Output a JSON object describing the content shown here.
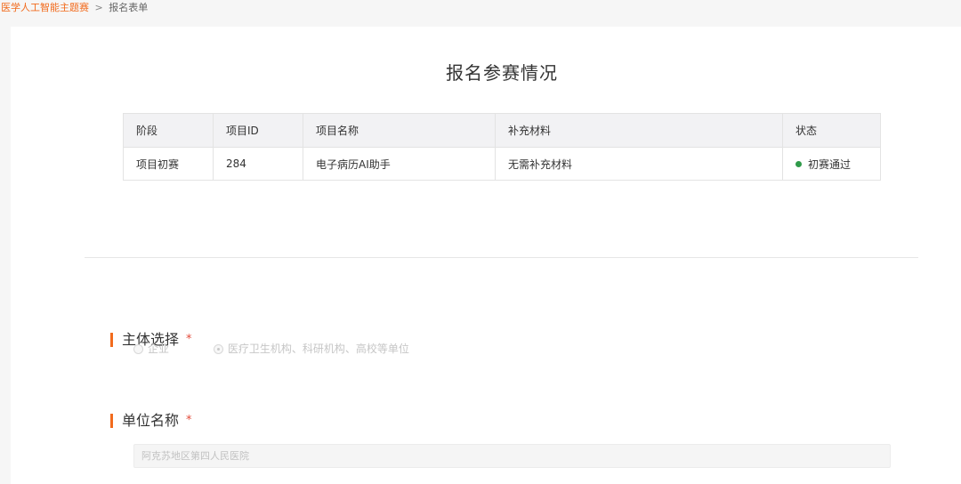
{
  "breadcrumb": {
    "parent": "医学人工智能主题赛",
    "separator": ">",
    "current": "报名表单"
  },
  "page_title": "报名参赛情况",
  "table": {
    "headers": [
      "阶段",
      "项目ID",
      "项目名称",
      "补充材料",
      "状态"
    ],
    "rows": [
      {
        "stage": "项目初赛",
        "project_id": "284",
        "project_name": "电子病历AI助手",
        "materials": "无需补充材料",
        "status": "初赛通过"
      }
    ]
  },
  "status_color": "#2f9a4a",
  "accent_color": "#f26b1d",
  "sections": {
    "entity": {
      "label": "主体选择",
      "required_mark": "*",
      "options": [
        {
          "label": "企业",
          "checked": false
        },
        {
          "label": "医疗卫生机构、科研机构、高校等单位",
          "checked": true
        }
      ]
    },
    "unit_name": {
      "label": "单位名称",
      "required_mark": "*",
      "value": "阿克苏地区第四人民医院"
    }
  }
}
